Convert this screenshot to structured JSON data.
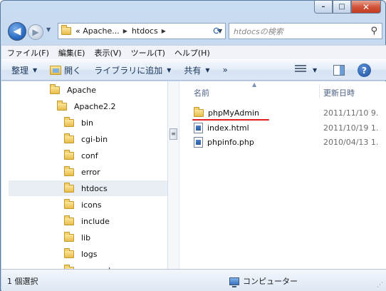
{
  "window": {
    "min_glyph": "–",
    "max_glyph": "□",
    "close_glyph": "✕"
  },
  "navigation": {
    "back_glyph": "◀",
    "forward_glyph": "▶",
    "address_crumbs": [
      "« Apache...",
      "htdocs"
    ],
    "search_placeholder": "htdocsの検索"
  },
  "menu": [
    "ファイル(F)",
    "編集(E)",
    "表示(V)",
    "ツール(T)",
    "ヘルプ(H)"
  ],
  "commands": {
    "organize": "整理",
    "open": "開く",
    "include_library": "ライブラリに追加",
    "share": "共有",
    "more": "»",
    "help_glyph": "?"
  },
  "tree": [
    {
      "label": "Apache",
      "indent": 1
    },
    {
      "label": "Apache2.2",
      "indent": 2
    },
    {
      "label": "bin",
      "indent": 3
    },
    {
      "label": "cgi-bin",
      "indent": 3
    },
    {
      "label": "conf",
      "indent": 3
    },
    {
      "label": "error",
      "indent": 3
    },
    {
      "label": "htdocs",
      "indent": 3,
      "selected": true
    },
    {
      "label": "icons",
      "indent": 3
    },
    {
      "label": "include",
      "indent": 3
    },
    {
      "label": "lib",
      "indent": 3
    },
    {
      "label": "logs",
      "indent": 3
    },
    {
      "label": "manual",
      "indent": 3
    }
  ],
  "columns": {
    "name": "名前",
    "date": "更新日時"
  },
  "files": [
    {
      "name": "phpMyAdmin",
      "date": "2011/11/10 9.",
      "type": "folder",
      "selected": true
    },
    {
      "name": "index.html",
      "date": "2011/10/19 1.",
      "type": "file"
    },
    {
      "name": "phpinfo.php",
      "date": "2010/04/13 1.",
      "type": "file"
    }
  ],
  "status": {
    "selection": "1 個選択",
    "location": "コンピューター"
  },
  "colors": {
    "accent": "#2b6cc4",
    "highlight_underline": "#e02020"
  }
}
